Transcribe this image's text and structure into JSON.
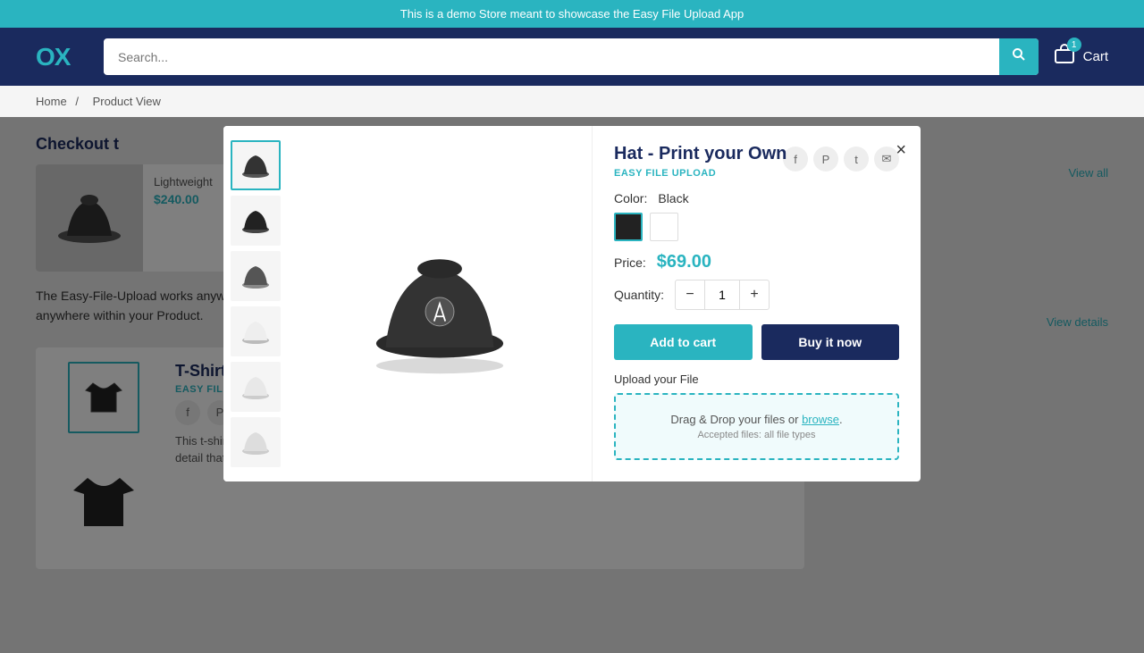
{
  "announcement": {
    "text": "This is a demo Store meant to showcase the Easy File Upload App"
  },
  "header": {
    "logo": "OX",
    "search_placeholder": "Search...",
    "cart_label": "Cart",
    "cart_count": "1"
  },
  "breadcrumb": {
    "home": "Home",
    "separator": "/",
    "current": "Product View"
  },
  "page": {
    "checkout_label": "Checkout t",
    "view_all": "View all",
    "background_product": {
      "name": "Lightweight",
      "price": "$240.00"
    },
    "efu_description": "The Easy-File-Upload works anywhere within a Product Form and you can use a simple CSS class or 2.0 Theme to position it anywhere within your Product.",
    "view_details": "View details"
  },
  "modal": {
    "title": "Hat - Print your Own",
    "badge": "EASY FILE UPLOAD",
    "close_label": "×",
    "color_label": "Color:",
    "color_value": "Black",
    "colors": [
      "black",
      "white"
    ],
    "price_label": "Price:",
    "price_value": "$69.00",
    "quantity_label": "Quantity:",
    "quantity_value": "1",
    "qty_minus": "−",
    "qty_plus": "+",
    "add_to_cart": "Add to cart",
    "buy_now": "Buy it now",
    "upload_label": "Upload your File",
    "upload_text": "Drag & Drop your files or",
    "browse_text": "browse",
    "upload_period": ".",
    "accepted_files": "Accepted files: all file types",
    "thumbnails": [
      "thumb1",
      "thumb2",
      "thumb3",
      "thumb4",
      "thumb5",
      "thumb6"
    ]
  },
  "tshirt": {
    "title": "T-Shirt - Print your Own",
    "badge": "EASY FILE UPLOAD",
    "description": "This t-shirt is a must-have in your wardrobe, combining the timeless fit of a classic tee with an intricate embroidered detail that brings the shirt to a whole new level. It's soft and"
  },
  "social": {
    "facebook": "f",
    "pinterest": "P",
    "twitter": "t",
    "email": "✉"
  }
}
